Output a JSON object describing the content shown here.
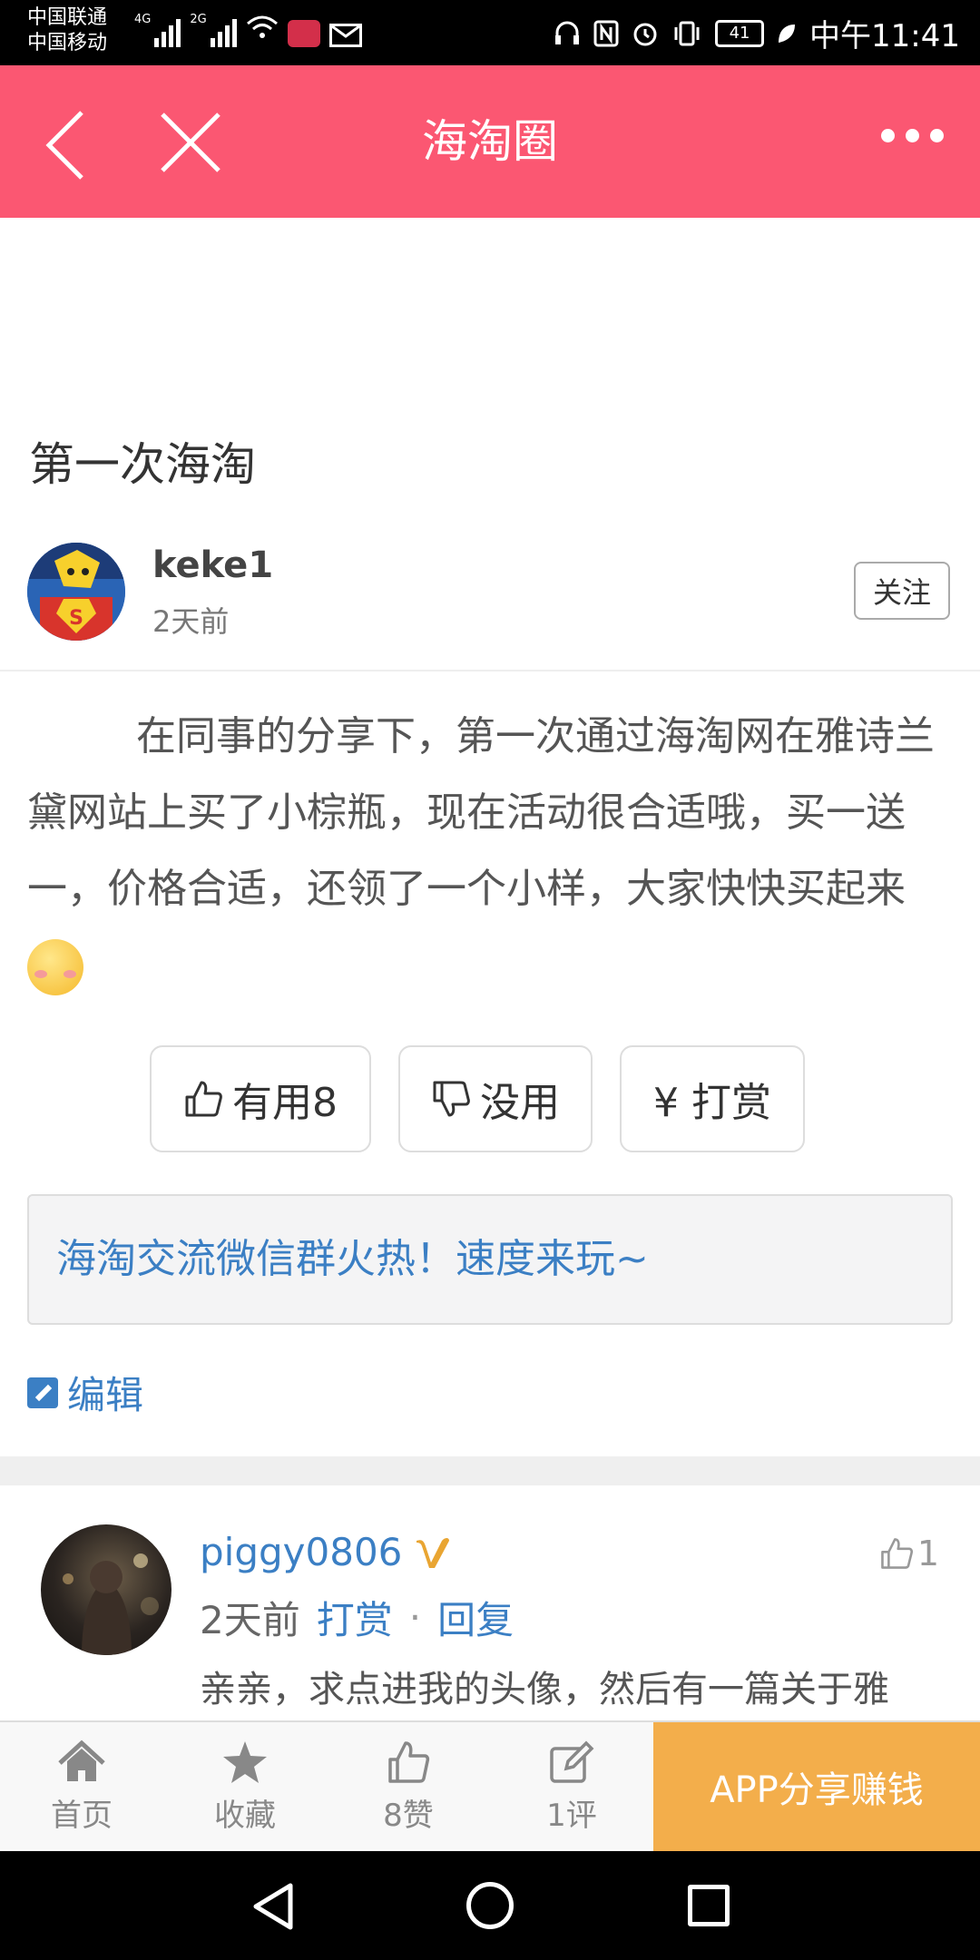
{
  "status_bar": {
    "carrier_1": "中国联通",
    "carrier_2": "中国移动",
    "net_1": "4G",
    "net_2": "2G",
    "battery": "41",
    "time": "中午11:41"
  },
  "header": {
    "title": "海淘圈",
    "color": "#fb5772"
  },
  "post": {
    "title": "第一次海淘",
    "author": {
      "name": "keke1",
      "time": "2天前",
      "follow_label": "关注"
    },
    "body": "在同事的分享下，第一次通过海淘网在雅诗兰黛网站上买了小棕瓶，现在活动很合适哦，买一送一，价格合适，还领了一个小样，大家快快买起来",
    "actions": {
      "useful_label": "有用8",
      "useless_label": "没用",
      "reward_label": "¥ 打赏"
    },
    "banner_text": "海淘交流微信群火热！速度来玩~",
    "edit_label": "编辑"
  },
  "comment": {
    "user": "piggy0806",
    "likes": "1",
    "time": "2天前",
    "reward_label": "打赏",
    "separator": "·",
    "reply_label": "回复",
    "text": "亲亲，求点进我的头像，然后有一篇关于雅"
  },
  "tabbar": {
    "home_label": "首页",
    "fav_label": "收藏",
    "like_label": "8赞",
    "comment_label": "1评",
    "share_label": "APP分享赚钱",
    "share_color": "#f3ae4b"
  }
}
